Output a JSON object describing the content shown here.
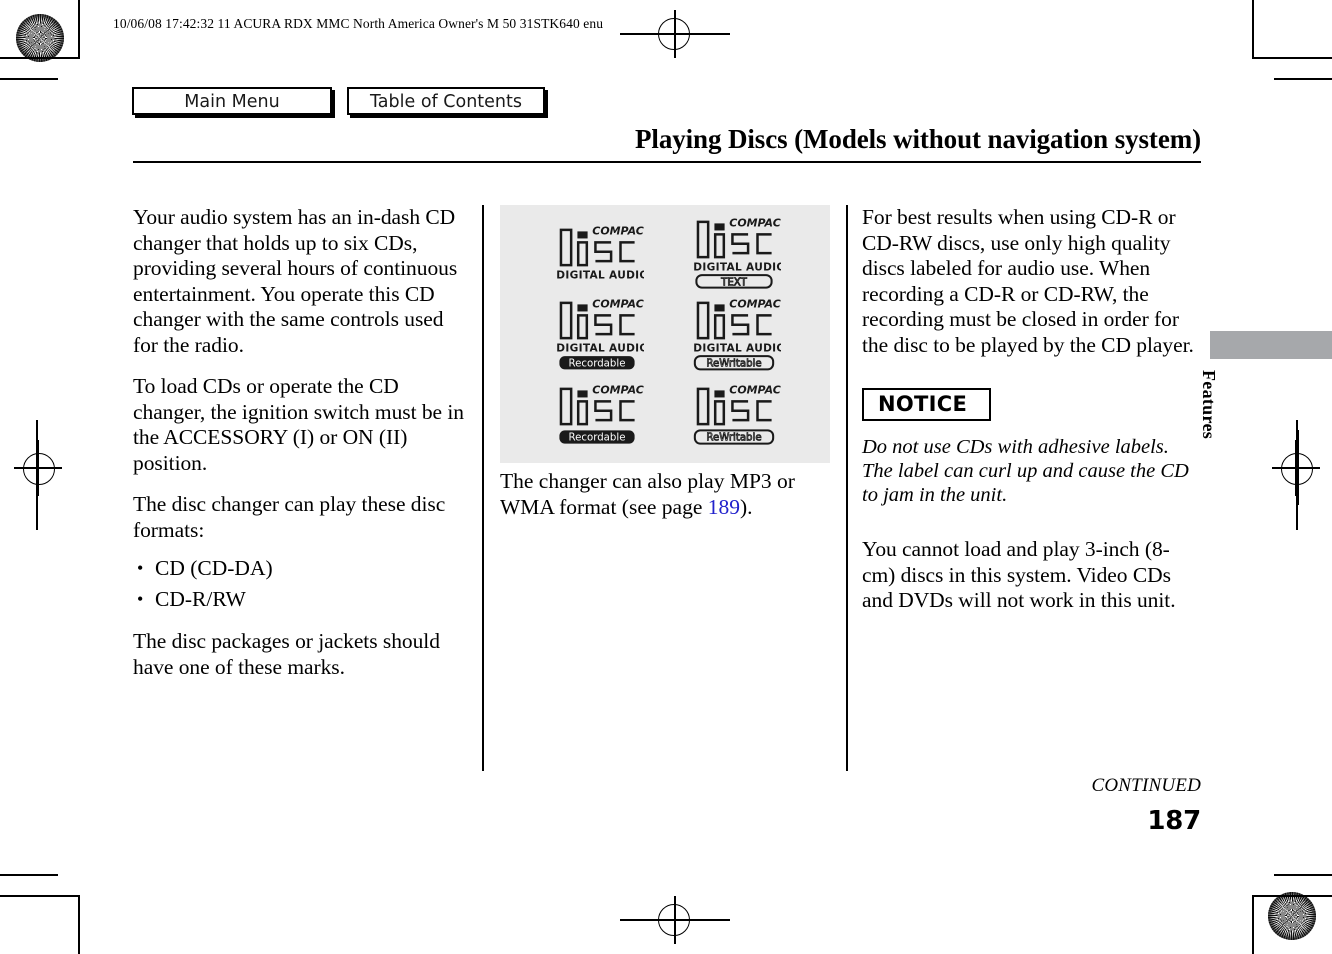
{
  "document": {
    "header_line": "10/06/08 17:42:32   11 ACURA RDX MMC North America Owner's M 50 31STK640 enu",
    "title": "Playing Discs (Models without navigation system)",
    "page_number": "187",
    "continued_label": "CONTINUED",
    "side_tab_label": "Features"
  },
  "nav": {
    "main_menu": "Main Menu",
    "table_of_contents": "Table of Contents"
  },
  "columns": {
    "left": {
      "paragraph_1": "Your audio system has an in-dash CD changer that holds up to six CDs, providing several hours of continuous entertainment. You operate this CD changer with the same controls used for the radio.",
      "paragraph_2": "To load CDs or operate the CD changer, the ignition switch must be in the ACCESSORY (I) or ON (II) position.",
      "paragraph_3": "The disc changer can play these disc formats:",
      "formats": [
        "CD (CD-DA)",
        "CD-R/RW"
      ],
      "paragraph_4": "The disc packages or jackets should have one of these marks."
    },
    "middle": {
      "caption_before_link": "The changer can also play MP3 or WMA format (see page ",
      "caption_link": "189",
      "caption_after_link": ").",
      "logos": [
        {
          "top_text": "COMPACT",
          "word": "disc",
          "bottom_text": "DIGITAL AUDIO",
          "badge": null,
          "badge_style": "none"
        },
        {
          "top_text": "COMPACT",
          "word": "disc",
          "bottom_text": "DIGITAL AUDIO",
          "badge": "TEXT",
          "badge_style": "outline"
        },
        {
          "top_text": "COMPACT",
          "word": "disc",
          "bottom_text": "DIGITAL AUDIO",
          "badge": "Recordable",
          "badge_style": "filled"
        },
        {
          "top_text": "COMPACT",
          "word": "disc",
          "bottom_text": "DIGITAL AUDIO",
          "badge": "ReWritable",
          "badge_style": "outline"
        },
        {
          "top_text": "COMPACT",
          "word": "disc",
          "bottom_text": null,
          "badge": "Recordable",
          "badge_style": "filled"
        },
        {
          "top_text": "COMPACT",
          "word": "disc",
          "bottom_text": null,
          "badge": "ReWritable",
          "badge_style": "outline"
        }
      ]
    },
    "right": {
      "paragraph_1": "For best results when using CD-R or CD-RW discs, use only high quality discs labeled for audio use. When recording a CD-R or CD-RW, the recording must be closed in order for the disc to be played by the CD player.",
      "notice_label": "NOTICE",
      "notice_text": "Do not use CDs with adhesive labels. The label can curl up and cause the CD to jam in the unit.",
      "paragraph_2": "You cannot load and play 3-inch (8-cm) discs in this system. Video CDs and DVDs will not work in this unit."
    }
  },
  "colors": {
    "link": "#2222cc",
    "figure_background": "#eaeaea",
    "tab_gray": "#a6a8ab",
    "text": "#000000"
  }
}
